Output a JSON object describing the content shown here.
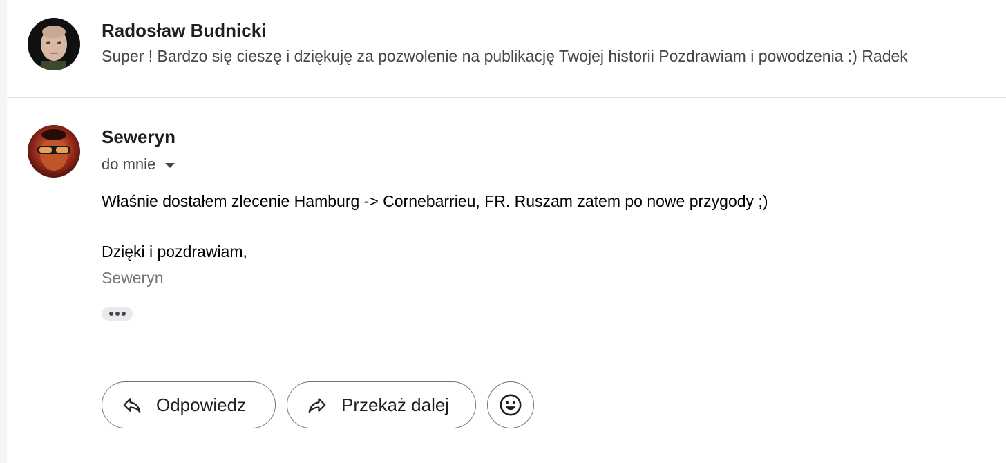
{
  "thread": {
    "messages": [
      {
        "sender": "Radosław Budnicki",
        "snippet": "Super ! Bardzo się cieszę i dziękuję za pozwolenie na publikację Twojej historii Pozdrawiam i powodzenia :) Radek"
      },
      {
        "sender": "Seweryn",
        "recipient": "do mnie",
        "body": [
          "Właśnie dostałem zlecenie Hamburg -> Cornebarrieu, FR. Ruszam zatem po nowe przygody ;)",
          "Dzięki i pozdrawiam,"
        ],
        "signature": "Seweryn"
      }
    ]
  },
  "actions": {
    "reply_label": "Odpowiedz",
    "forward_label": "Przekaż dalej",
    "emoji_icon": "smiley-icon"
  },
  "icons": {
    "reply": "reply-arrow-icon",
    "forward": "forward-arrow-icon",
    "show_trimmed": "more-horiz-icon",
    "recipient_details": "caret-down-icon"
  }
}
